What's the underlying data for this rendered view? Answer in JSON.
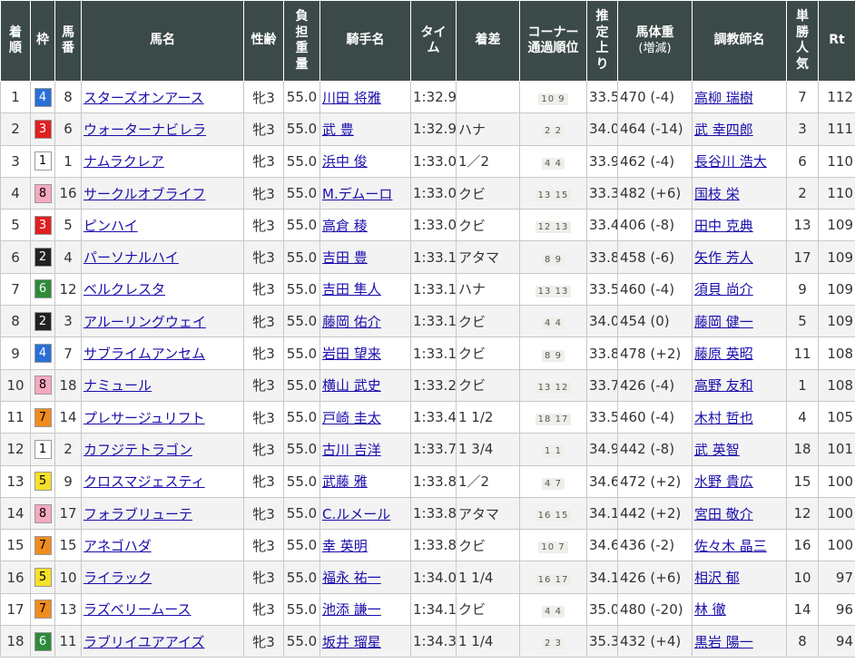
{
  "headers": {
    "rank": "着\n順",
    "waku": "枠",
    "num": "馬\n番",
    "horse": "馬名",
    "sexage": "性齢",
    "weight": "負\n担\n重\n量",
    "jockey": "騎手名",
    "time": "タイ\nム",
    "margin": "着差",
    "corner": "コーナー\n通過順位",
    "last3f": "推\n定\n上\nり",
    "bodyweight": "馬体重",
    "bodyweight_sub": "(増減)",
    "trainer": "調教師名",
    "odds_rank": "単\n勝\n人\n気",
    "rt": "Rt"
  },
  "waku_colors": {
    "1": {
      "bg": "#ffffff",
      "fg": "#000000"
    },
    "2": {
      "bg": "#222222",
      "fg": "#ffffff"
    },
    "3": {
      "bg": "#e02020",
      "fg": "#ffffff"
    },
    "4": {
      "bg": "#2a6fd6",
      "fg": "#ffffff"
    },
    "5": {
      "bg": "#f5e02a",
      "fg": "#000000"
    },
    "6": {
      "bg": "#2e8b3a",
      "fg": "#ffffff"
    },
    "7": {
      "bg": "#f08c1e",
      "fg": "#000000"
    },
    "8": {
      "bg": "#f7a9c0",
      "fg": "#000000"
    }
  },
  "rows": [
    {
      "rank": "1",
      "waku": "4",
      "num": "8",
      "horse": "スターズオンアース",
      "sexage": "牝3",
      "weight": "55.0",
      "jockey": "川田 将雅",
      "time": "1:32.9",
      "margin": "",
      "corner": "10 9",
      "last3f": "33.5",
      "bodyweight": "470 (-4)",
      "trainer": "高柳 瑞樹",
      "odds_rank": "7",
      "rt": "112"
    },
    {
      "rank": "2",
      "waku": "3",
      "num": "6",
      "horse": "ウォーターナビレラ",
      "sexage": "牝3",
      "weight": "55.0",
      "jockey": "武 豊",
      "time": "1:32.9",
      "margin": "ハナ",
      "corner": "2 2",
      "last3f": "34.0",
      "bodyweight": "464 (-14)",
      "trainer": "武 幸四郎",
      "odds_rank": "3",
      "rt": "111"
    },
    {
      "rank": "3",
      "waku": "1",
      "num": "1",
      "horse": "ナムラクレア",
      "sexage": "牝3",
      "weight": "55.0",
      "jockey": "浜中 俊",
      "time": "1:33.0",
      "margin": "1／2",
      "corner": "4 4",
      "last3f": "33.9",
      "bodyweight": "462 (-4)",
      "trainer": "長谷川 浩大",
      "odds_rank": "6",
      "rt": "110"
    },
    {
      "rank": "4",
      "waku": "8",
      "num": "16",
      "horse": "サークルオブライフ",
      "sexage": "牝3",
      "weight": "55.0",
      "jockey": "M.デムーロ",
      "time": "1:33.0",
      "margin": "クビ",
      "corner": "13 15",
      "last3f": "33.3",
      "bodyweight": "482 (+6)",
      "trainer": "国枝 栄",
      "odds_rank": "2",
      "rt": "110"
    },
    {
      "rank": "5",
      "waku": "3",
      "num": "5",
      "horse": "ピンハイ",
      "sexage": "牝3",
      "weight": "55.0",
      "jockey": "高倉 稜",
      "time": "1:33.0",
      "margin": "クビ",
      "corner": "12 13",
      "last3f": "33.4",
      "bodyweight": "406 (-8)",
      "trainer": "田中 克典",
      "odds_rank": "13",
      "rt": "109"
    },
    {
      "rank": "6",
      "waku": "2",
      "num": "4",
      "horse": "パーソナルハイ",
      "sexage": "牝3",
      "weight": "55.0",
      "jockey": "吉田 豊",
      "time": "1:33.1",
      "margin": "アタマ",
      "corner": "8 9",
      "last3f": "33.8",
      "bodyweight": "458 (-6)",
      "trainer": "矢作 芳人",
      "odds_rank": "17",
      "rt": "109"
    },
    {
      "rank": "7",
      "waku": "6",
      "num": "12",
      "horse": "ベルクレスタ",
      "sexage": "牝3",
      "weight": "55.0",
      "jockey": "吉田 隼人",
      "time": "1:33.1",
      "margin": "ハナ",
      "corner": "13 13",
      "last3f": "33.5",
      "bodyweight": "460 (-4)",
      "trainer": "須貝 尚介",
      "odds_rank": "9",
      "rt": "109"
    },
    {
      "rank": "8",
      "waku": "2",
      "num": "3",
      "horse": "アルーリングウェイ",
      "sexage": "牝3",
      "weight": "55.0",
      "jockey": "藤岡 佑介",
      "time": "1:33.1",
      "margin": "クビ",
      "corner": "4 4",
      "last3f": "34.0",
      "bodyweight": "454 (0)",
      "trainer": "藤岡 健一",
      "odds_rank": "5",
      "rt": "109"
    },
    {
      "rank": "9",
      "waku": "4",
      "num": "7",
      "horse": "サブライムアンセム",
      "sexage": "牝3",
      "weight": "55.0",
      "jockey": "岩田 望来",
      "time": "1:33.1",
      "margin": "クビ",
      "corner": "8 9",
      "last3f": "33.8",
      "bodyweight": "478 (+2)",
      "trainer": "藤原 英昭",
      "odds_rank": "11",
      "rt": "108"
    },
    {
      "rank": "10",
      "waku": "8",
      "num": "18",
      "horse": "ナミュール",
      "sexage": "牝3",
      "weight": "55.0",
      "jockey": "横山 武史",
      "time": "1:33.2",
      "margin": "クビ",
      "corner": "13 12",
      "last3f": "33.7",
      "bodyweight": "426 (-4)",
      "trainer": "高野 友和",
      "odds_rank": "1",
      "rt": "108"
    },
    {
      "rank": "11",
      "waku": "7",
      "num": "14",
      "horse": "プレサージュリフト",
      "sexage": "牝3",
      "weight": "55.0",
      "jockey": "戸崎 圭太",
      "time": "1:33.4",
      "margin": "1 1/2",
      "corner": "18 17",
      "last3f": "33.5",
      "bodyweight": "460 (-4)",
      "trainer": "木村 哲也",
      "odds_rank": "4",
      "rt": "105"
    },
    {
      "rank": "12",
      "waku": "1",
      "num": "2",
      "horse": "カフジテトラゴン",
      "sexage": "牝3",
      "weight": "55.0",
      "jockey": "古川 吉洋",
      "time": "1:33.7",
      "margin": "1 3/4",
      "corner": "1 1",
      "last3f": "34.9",
      "bodyweight": "442 (-8)",
      "trainer": "武 英智",
      "odds_rank": "18",
      "rt": "101"
    },
    {
      "rank": "13",
      "waku": "5",
      "num": "9",
      "horse": "クロスマジェスティ",
      "sexage": "牝3",
      "weight": "55.0",
      "jockey": "武藤 雅",
      "time": "1:33.8",
      "margin": "1／2",
      "corner": "4 7",
      "last3f": "34.6",
      "bodyweight": "472 (+2)",
      "trainer": "水野 貴広",
      "odds_rank": "15",
      "rt": "100"
    },
    {
      "rank": "14",
      "waku": "8",
      "num": "17",
      "horse": "フォラブリューテ",
      "sexage": "牝3",
      "weight": "55.0",
      "jockey": "C.ルメール",
      "time": "1:33.8",
      "margin": "アタマ",
      "corner": "16 15",
      "last3f": "34.1",
      "bodyweight": "442 (+2)",
      "trainer": "宮田 敬介",
      "odds_rank": "12",
      "rt": "100"
    },
    {
      "rank": "15",
      "waku": "7",
      "num": "15",
      "horse": "アネゴハダ",
      "sexage": "牝3",
      "weight": "55.0",
      "jockey": "幸 英明",
      "time": "1:33.8",
      "margin": "クビ",
      "corner": "10 7",
      "last3f": "34.6",
      "bodyweight": "436 (-2)",
      "trainer": "佐々木 晶三",
      "odds_rank": "16",
      "rt": "100"
    },
    {
      "rank": "16",
      "waku": "5",
      "num": "10",
      "horse": "ライラック",
      "sexage": "牝3",
      "weight": "55.0",
      "jockey": "福永 祐一",
      "time": "1:34.0",
      "margin": "1 1/4",
      "corner": "16 17",
      "last3f": "34.1",
      "bodyweight": "426 (+6)",
      "trainer": "相沢 郁",
      "odds_rank": "10",
      "rt": "97"
    },
    {
      "rank": "17",
      "waku": "7",
      "num": "13",
      "horse": "ラズベリームース",
      "sexage": "牝3",
      "weight": "55.0",
      "jockey": "池添 謙一",
      "time": "1:34.1",
      "margin": "クビ",
      "corner": "4 4",
      "last3f": "35.0",
      "bodyweight": "480 (-20)",
      "trainer": "林 徹",
      "odds_rank": "14",
      "rt": "96"
    },
    {
      "rank": "18",
      "waku": "6",
      "num": "11",
      "horse": "ラブリイユアアイズ",
      "sexage": "牝3",
      "weight": "55.0",
      "jockey": "坂井 瑠星",
      "time": "1:34.3",
      "margin": "1 1/4",
      "corner": "2 3",
      "last3f": "35.3",
      "bodyweight": "432 (+4)",
      "trainer": "黒岩 陽一",
      "odds_rank": "8",
      "rt": "94"
    }
  ]
}
